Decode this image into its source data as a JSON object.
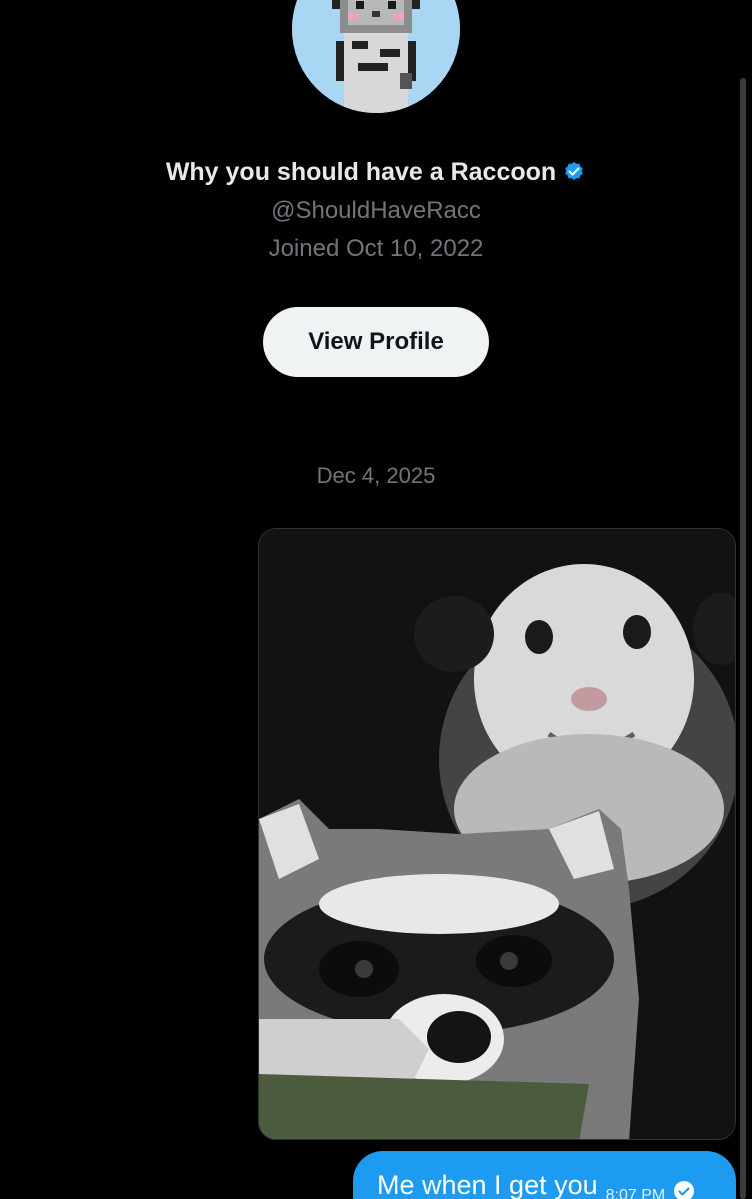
{
  "profile": {
    "display_name": "Why you should have a Raccoon",
    "handle": "@ShouldHaveRacc",
    "joined": "Joined Oct 10, 2022",
    "view_profile_label": "View Profile",
    "verified_icon": "verified-badge-icon",
    "accent_color": "#1d9bf0"
  },
  "conversation": {
    "date_separator": "Dec 4, 2025",
    "messages": [
      {
        "type": "media",
        "media_description_icon": "meme-image"
      },
      {
        "type": "text",
        "text": "Me when I get you",
        "time": "8:07 PM",
        "status_icon": "read-check-icon"
      }
    ]
  }
}
